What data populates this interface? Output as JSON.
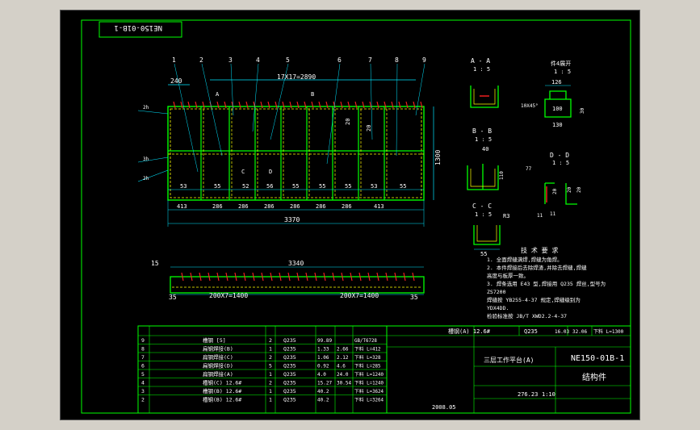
{
  "colors": {
    "background": "#000000",
    "frame": "#00ff00",
    "dimension": "#00e5ff",
    "part": "#ffff00",
    "weld": "#ff2020",
    "text": "#ffffff",
    "gray": "#d4d0c8"
  },
  "drawing_code_flipped": "NE150-01B-1",
  "title_block": {
    "drawing_no": "NE150-01B-1",
    "name": "结构件",
    "part_name": "三层工作平台(A)",
    "weight": "276.23",
    "scale": "1:10",
    "date": "2008.05"
  },
  "main_view": {
    "top_overall": "17X17=2890",
    "left_offset": "240",
    "height": "1300",
    "bottom_cells": [
      "53",
      "55",
      "52",
      "56",
      "55",
      "55",
      "55",
      "53",
      "55"
    ],
    "bottom_spans": [
      "413",
      "286",
      "286",
      "286",
      "286",
      "286",
      "286",
      "413"
    ],
    "overall": "3370",
    "balloons": [
      "1",
      "2",
      "3",
      "4",
      "5",
      "6",
      "7",
      "8",
      "9"
    ],
    "section_marks": {
      "a": "A",
      "b": "B",
      "c": "C",
      "d": "D"
    },
    "dims_vertical": [
      "20",
      "20"
    ],
    "weld_labels": [
      "2h",
      "3h",
      "2h"
    ]
  },
  "side_view": {
    "overall": "3340",
    "left_len": "15",
    "left_end": "35",
    "right_end": "35",
    "span_left": "200X7=1400",
    "span_right": "200X7=1400"
  },
  "sections": {
    "aa": {
      "title": "A - A",
      "scale": "1 : 5"
    },
    "bb": {
      "title": "B - B",
      "scale": "1 : 5",
      "dim": "40",
      "dim2": "110"
    },
    "cc": {
      "title": "C - C",
      "scale": "1 : 5",
      "dim": "55",
      "radius": "R3"
    },
    "dd": {
      "title": "D - D",
      "scale": "1 : 5",
      "dims": [
        "11",
        "20",
        "20",
        "20",
        "77",
        "11"
      ]
    },
    "detail": {
      "title": "件4展开",
      "scale": "1 : 5",
      "dims": [
        "126",
        "100",
        "130",
        "30"
      ],
      "chamfer": "10X45°"
    }
  },
  "notes": {
    "title": "技 术 要 求",
    "lines": [
      "1. 全面焊缝满焊,焊缝为角焊。",
      "2. 本件焊接后去除焊渣,并除去焊缝,焊缝",
      "   高度与板厚一致。",
      "3. 焊条选用 E43 型,焊接用 Q235 焊丝,型号为",
      "   ZS7200",
      "   焊缝按 YB255-4-37 规定,焊缝级别为",
      "   YDX4DD.",
      "   检验标准按 JB/T XWD2.2-4-37"
    ]
  },
  "bom": {
    "rows": [
      {
        "no": "9",
        "name": "槽钢 [5]",
        "qty": "2",
        "mat": "Q235",
        "w1": "99.89",
        "w2": "",
        "note": "GB/T6728"
      },
      {
        "no": "8",
        "name": "扁钢焊接(B)",
        "qty": "1",
        "mat": "Q235",
        "w1": "1.33",
        "w2": "2.66",
        "note": "下料 L=412"
      },
      {
        "no": "7",
        "name": "扁钢焊接(C)",
        "qty": "2",
        "mat": "Q235",
        "w1": "1.06",
        "w2": "2.12",
        "note": "下料 L=328"
      },
      {
        "no": "6",
        "name": "扁钢焊接(D)",
        "qty": "5",
        "mat": "Q235",
        "w1": "0.92",
        "w2": "4.6",
        "note": "下料 L=285"
      },
      {
        "no": "5",
        "name": "扁钢焊接(A)",
        "qty": "1",
        "mat": "Q235",
        "w1": "4.0",
        "w2": "24.0",
        "note": "下料 L=1240"
      },
      {
        "no": "4",
        "name": "槽钢(C) 12.6#",
        "qty": "2",
        "mat": "Q235",
        "w1": "15.27",
        "w2": "30.54",
        "note": "下料 L=1240"
      },
      {
        "no": "3",
        "name": "槽钢(B) 12.6#",
        "qty": "1",
        "mat": "Q235",
        "w1": "40.2",
        "w2": "",
        "note": "下料 L=3624"
      },
      {
        "no": "2",
        "name": "槽钢(B) 12.6#",
        "qty": "1",
        "mat": "Q235",
        "w1": "40.2",
        "w2": "",
        "note": "下料 L=3264"
      }
    ],
    "row1": {
      "name": "槽钢(A) 12.6#",
      "mat": "Q235",
      "a": "16.03",
      "b": "32.06",
      "note": "下料 L=1300"
    }
  }
}
